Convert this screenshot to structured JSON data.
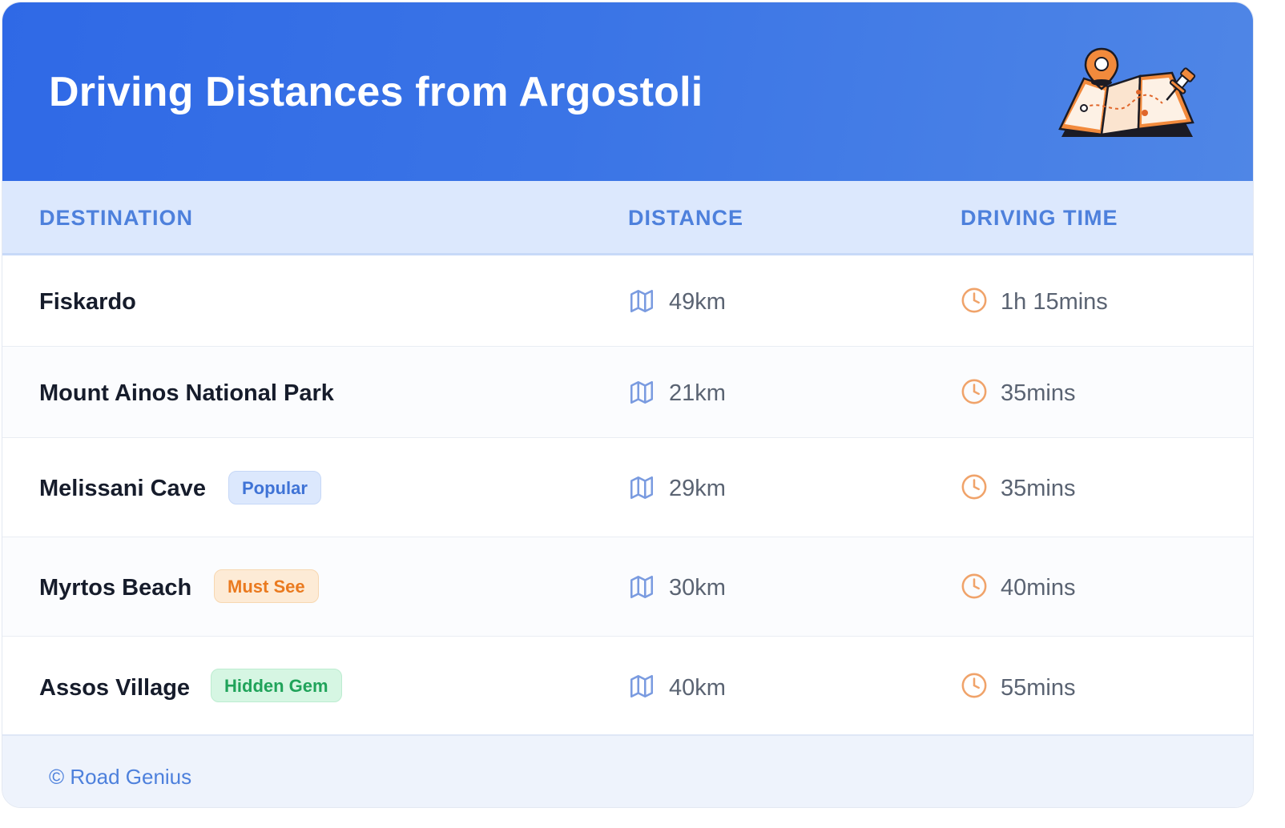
{
  "header": {
    "title": "Driving Distances from Argostoli",
    "illustration_icon": "folded-map-with-pins-icon"
  },
  "table": {
    "columns": [
      "DESTINATION",
      "DISTANCE",
      "DRIVING TIME"
    ],
    "distance_icon": "map-icon",
    "time_icon": "clock-icon",
    "rows": [
      {
        "destination": "Fiskardo",
        "badge": "",
        "distance": "49km",
        "time": "1h 15mins"
      },
      {
        "destination": "Mount Ainos National Park",
        "badge": "",
        "distance": "21km",
        "time": "35mins"
      },
      {
        "destination": "Melissani Cave",
        "badge": "Popular",
        "distance": "29km",
        "time": "35mins"
      },
      {
        "destination": "Myrtos Beach",
        "badge": "Must See",
        "distance": "30km",
        "time": "40mins"
      },
      {
        "destination": "Assos Village",
        "badge": "Hidden Gem",
        "distance": "40km",
        "time": "55mins"
      }
    ]
  },
  "footer": {
    "credit": "© Road Genius"
  },
  "colors": {
    "header_blue": "#2f69e6",
    "accent_blue": "#4d80dc",
    "orange": "#ea7a1f",
    "green": "#20a35a"
  }
}
